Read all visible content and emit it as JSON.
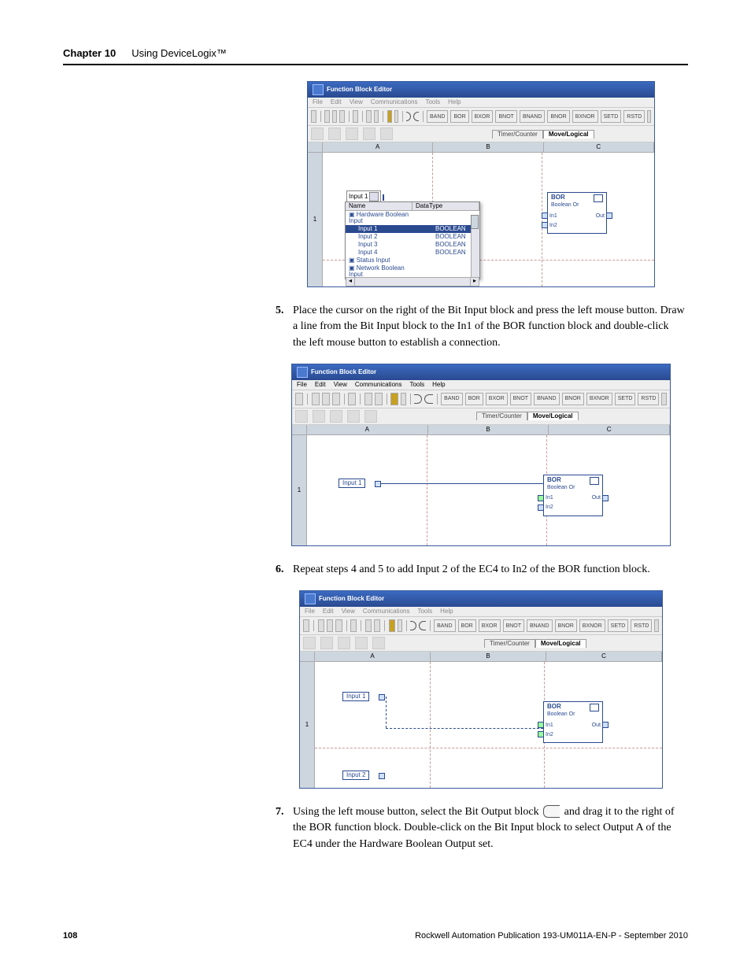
{
  "header": {
    "chapter_label": "Chapter 10",
    "chapter_title": "Using DeviceLogix™"
  },
  "footer": {
    "page_number": "108",
    "publication": "Rockwell Automation Publication 193-UM011A-EN-P - September 2010"
  },
  "step5": {
    "num": "5.",
    "text": "Place the cursor on the right of the Bit Input block and press the left mouse button.  Draw a line from the Bit Input block to the In1 of the BOR function block and double-click the left mouse button to establish a connection."
  },
  "step6": {
    "num": "6.",
    "text": "Repeat steps 4 and 5 to add Input 2 of the EC4 to In2 of the BOR function block."
  },
  "step7": {
    "num": "7.",
    "text_a": "Using the left mouse button, select the Bit Output block ",
    "text_b": " and drag it to the right of the BOR function block.  Double-click on the Bit Input block to select Output A of the EC4 under the Hardware Boolean Output set."
  },
  "editor": {
    "title": "Function Block Editor",
    "menus": [
      "File",
      "Edit",
      "View",
      "Communications",
      "Tools",
      "Help"
    ],
    "logic_buttons": [
      "BAND",
      "BOR",
      "BXOR",
      "BNOT",
      "BNAND",
      "BNOR",
      "BXNOR",
      "SETD",
      "RSTD"
    ],
    "tabs": {
      "left": "Timer/Counter",
      "active": "Move/Logical"
    },
    "columns": [
      "A",
      "B",
      "C"
    ],
    "row": "1",
    "input1": "Input 1",
    "input2": "Input 2",
    "bor": {
      "title": "BOR",
      "sub": "Boolean Or",
      "in1": "In1",
      "in2": "In2",
      "out": "Out"
    }
  },
  "dropdown": {
    "field": "Input 1",
    "headers": [
      "Name",
      "DataType"
    ],
    "group1": "Hardware Boolean Input",
    "rows": [
      {
        "n": "Input 1",
        "t": "BOOLEAN",
        "sel": true
      },
      {
        "n": "Input 2",
        "t": "BOOLEAN"
      },
      {
        "n": "Input 3",
        "t": "BOOLEAN"
      },
      {
        "n": "Input 4",
        "t": "BOOLEAN"
      }
    ],
    "group2": "Status Input",
    "group3": "Network Boolean Input"
  }
}
